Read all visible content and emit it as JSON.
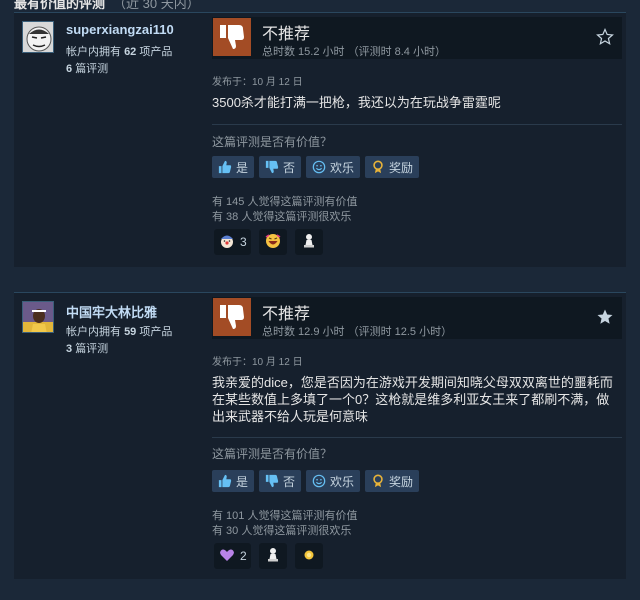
{
  "header": {
    "title": "最有价值的评测",
    "subtitle": "（近 30 天内）"
  },
  "reviews": [
    {
      "author": {
        "name": "superxiangzai110",
        "products_prefix": "帐户内拥有",
        "products_count": "62",
        "products_suffix": "项产品",
        "reviews_count": "6",
        "reviews_suffix": "篇评测"
      },
      "verdict": "不推荐",
      "hours": "总时数 15.2 小时 （评测时 8.4 小时）",
      "posted": "发布于：10 月 12 日",
      "body": "3500杀才能打满一把枪，我还以为在玩战争雷霆呢",
      "helpful_question": "这篇评测是否有价值？",
      "buttons": {
        "yes": "是",
        "no": "否",
        "funny": "欢乐",
        "award": "奖励"
      },
      "helpful_stat": "有 145 人觉得这篇评测有价值",
      "funny_stat": "有 38 人觉得这篇评测很欢乐",
      "awards": [
        {
          "icon": "clown-award-icon",
          "count": "3"
        },
        {
          "icon": "laughing-face-award-icon",
          "count": ""
        },
        {
          "icon": "pawn-award-icon",
          "count": ""
        }
      ]
    },
    {
      "author": {
        "name": "中国牢大林比雅",
        "products_prefix": "帐户内拥有",
        "products_count": "59",
        "products_suffix": "项产品",
        "reviews_count": "3",
        "reviews_suffix": "篇评测"
      },
      "verdict": "不推荐",
      "hours": "总时数 12.9 小时 （评测时 12.5 小时）",
      "posted": "发布于：10 月 12 日",
      "body": "我亲爱的dice，您是否因为在游戏开发期间知晓父母双双离世的噩耗而在某些数值上多填了一个0？这枪就是维多利亚女王来了都刷不满，做出来武器不给人玩是何意味",
      "helpful_question": "这篇评测是否有价值？",
      "buttons": {
        "yes": "是",
        "no": "否",
        "funny": "欢乐",
        "award": "奖励"
      },
      "helpful_stat": "有 101 人觉得这篇评测有价值",
      "funny_stat": "有 30 人觉得这篇评测很欢乐",
      "awards": [
        {
          "icon": "heart-hands-award-icon",
          "count": "2"
        },
        {
          "icon": "pawn-award-icon",
          "count": ""
        },
        {
          "icon": "gold-coin-award-icon",
          "count": ""
        }
      ]
    }
  ],
  "colors": {
    "background": "#1b2838",
    "review_bg": "#16202d",
    "thumb_down": "#a34c25",
    "button_bg": "#2a3f5a",
    "author_name": "#c1dbf4"
  }
}
